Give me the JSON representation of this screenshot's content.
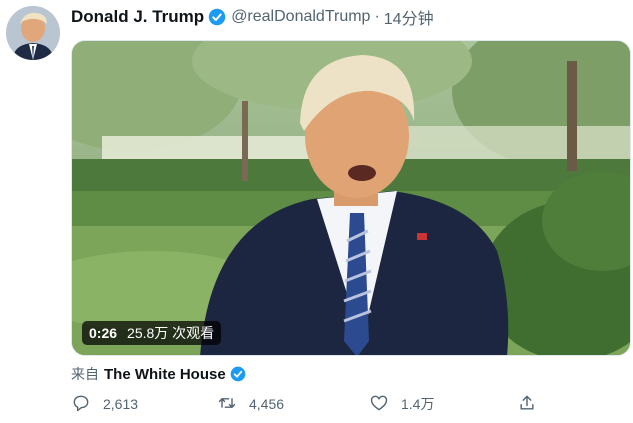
{
  "tweet": {
    "display_name": "Donald J. Trump",
    "handle": "@realDonaldTrump",
    "separator": "·",
    "time": "14分钟",
    "media": {
      "duration": "0:26",
      "views": "25.8万 次观看"
    },
    "source_prefix": "来自",
    "source_name": "The White House",
    "actions": {
      "reply_count": "2,613",
      "retweet_count": "4,456",
      "like_count": "1.4万"
    }
  },
  "colors": {
    "verified": "#1d9bf0",
    "text_secondary": "#536471",
    "text_primary": "#0f1419"
  },
  "icons": [
    "verified-badge-icon",
    "reply-icon",
    "retweet-icon",
    "like-icon",
    "share-icon"
  ]
}
